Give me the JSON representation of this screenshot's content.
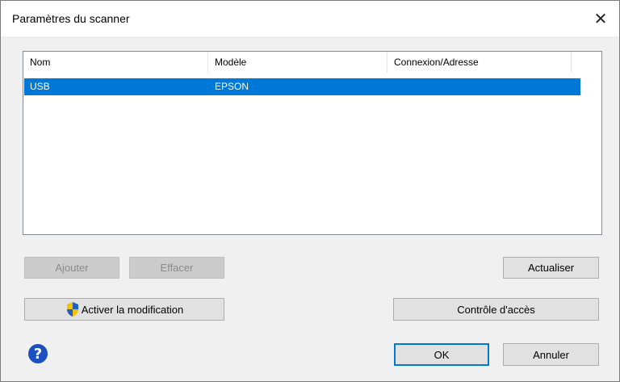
{
  "window": {
    "title": "Paramètres du scanner",
    "close_glyph": "✕"
  },
  "list": {
    "columns": [
      "Nom",
      "Modèle",
      "Connexion/Adresse"
    ],
    "rows": [
      {
        "nom": "USB",
        "modele": "EPSON",
        "connexion": "",
        "selected": true
      }
    ]
  },
  "buttons": {
    "ajouter": "Ajouter",
    "effacer": "Effacer",
    "actualiser": "Actualiser",
    "activer": "Activer la modification",
    "controle": "Contrôle d'accès",
    "ok": "OK",
    "annuler": "Annuler"
  },
  "help": {
    "glyph": "?"
  },
  "colors": {
    "selection": "#0078d7",
    "help_icon": "#1c4fbf",
    "shield_blue": "#1f5fbf",
    "shield_yellow": "#f2c200"
  },
  "icons": {
    "shield": "uac-shield-icon",
    "help": "help-icon",
    "close": "close-icon"
  }
}
